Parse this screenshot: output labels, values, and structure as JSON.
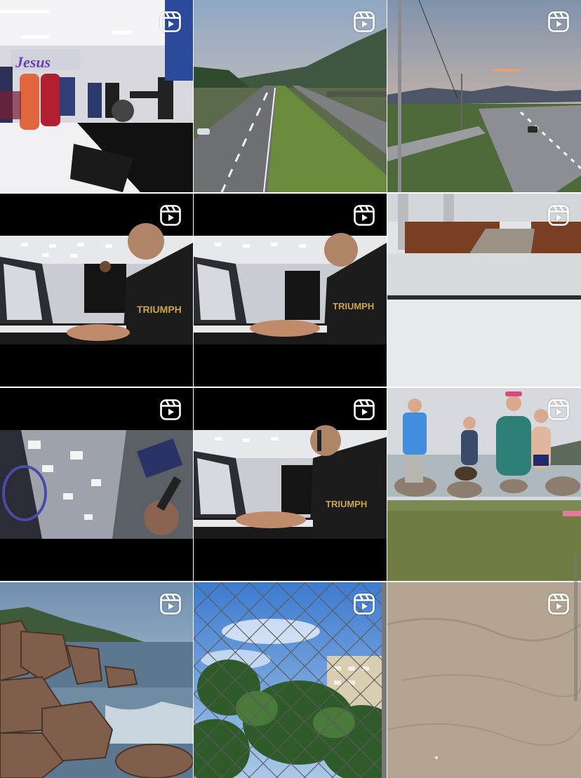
{
  "grid": {
    "item_type": "reel",
    "item_icon": "reels-icon",
    "sign_text": "Jesus",
    "shirt_text": "TRIUMPH",
    "items": [
      {
        "scene": "church-stage-band"
      },
      {
        "scene": "highway-mountain-dusk"
      },
      {
        "scene": "highway-sunset-streetlights"
      },
      {
        "scene": "piano-player-church"
      },
      {
        "scene": "piano-player-church"
      },
      {
        "scene": "empty-church-pews"
      },
      {
        "scene": "church-ceiling-selfie"
      },
      {
        "scene": "piano-player-church"
      },
      {
        "scene": "beach-group-rocks"
      },
      {
        "scene": "coastal-rocks-sea"
      },
      {
        "scene": "fence-net-trees"
      },
      {
        "scene": "sand-close-up"
      }
    ]
  }
}
